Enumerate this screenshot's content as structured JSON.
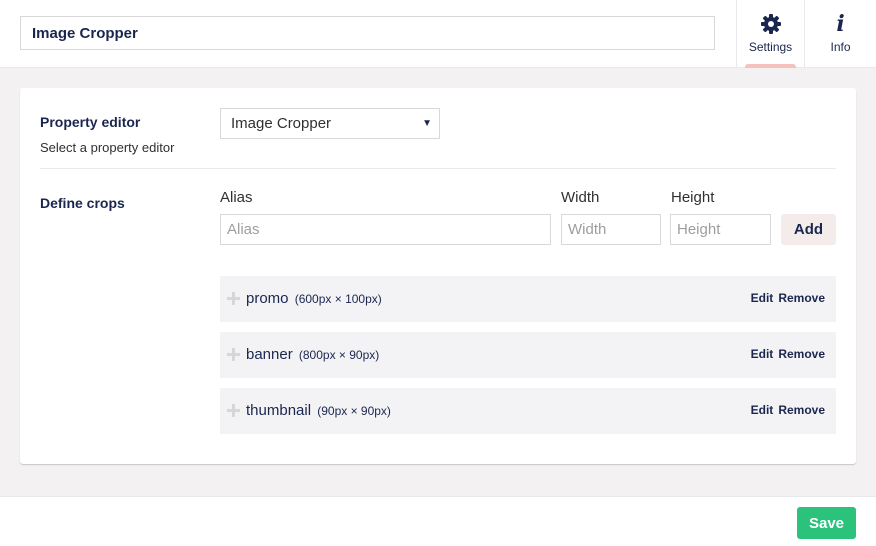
{
  "header": {
    "name_value": "Image Cropper",
    "apps": [
      {
        "label": "Settings",
        "icon": "gear-icon",
        "active": true
      },
      {
        "label": "Info",
        "icon": "info-icon",
        "active": false
      }
    ]
  },
  "property_editor": {
    "title": "Property editor",
    "description": "Select a property editor",
    "selected": "Image Cropper"
  },
  "crops": {
    "title": "Define crops",
    "alias_label": "Alias",
    "alias_placeholder": "Alias",
    "width_label": "Width",
    "width_placeholder": "Width",
    "height_label": "Height",
    "height_placeholder": "Height",
    "add_label": "Add",
    "items": [
      {
        "alias": "promo",
        "size": "(600px × 100px)",
        "edit_label": "Edit",
        "remove_label": "Remove"
      },
      {
        "alias": "banner",
        "size": "(800px × 90px)",
        "edit_label": "Edit",
        "remove_label": "Remove"
      },
      {
        "alias": "thumbnail",
        "size": "(90px × 90px)",
        "edit_label": "Edit",
        "remove_label": "Remove"
      }
    ]
  },
  "footer": {
    "save_label": "Save"
  },
  "colors": {
    "primary_text": "#1b264f",
    "save_button": "#2bc37c",
    "active_indicator": "#f5c1bc",
    "add_button_bg": "#f3ecea",
    "crop_row_bg": "#f3f3f5"
  }
}
